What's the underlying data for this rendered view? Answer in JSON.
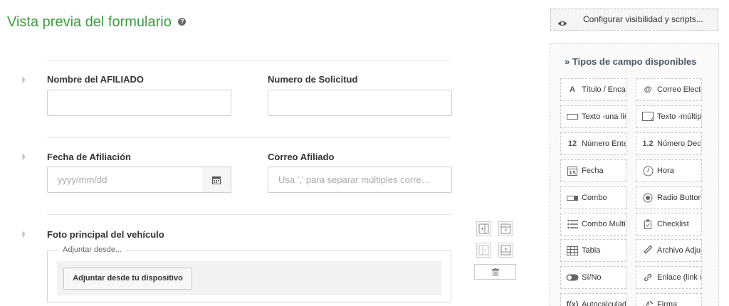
{
  "page": {
    "title": "Vista previa del formulario",
    "help_icon": "question-circle-icon"
  },
  "form": {
    "fields": {
      "nombre": {
        "label": "Nombre del AFILIADO",
        "value": ""
      },
      "solicitud": {
        "label": "Numero de Solicitud",
        "value": ""
      },
      "fecha": {
        "label": "Fecha de Afiliación",
        "placeholder": "yyyy/mm/dd"
      },
      "correo": {
        "label": "Correo Afiliado",
        "placeholder": "Usa ',' para separar múltiples corre…"
      },
      "foto": {
        "label": "Foto principal del vehículo",
        "legend": "Adjuntar desde...",
        "button": "Adjuntar desde tu dispositivo"
      }
    }
  },
  "toolbar": {
    "config_button": "Configurar visibilidad y scripts..."
  },
  "panel": {
    "title": "» Tipos de campo disponibles",
    "items": [
      {
        "icon": "A",
        "label": "Título / Encabezado"
      },
      {
        "icon": "@",
        "label": "Correo Electrónico"
      },
      {
        "icon": "text-line-icon",
        "label": "Texto -una línea"
      },
      {
        "icon": "textarea-icon",
        "label": "Texto -múltiples líneas"
      },
      {
        "icon": "12",
        "label": "Número Entero"
      },
      {
        "icon": "1.2",
        "label": "Número Decimal"
      },
      {
        "icon": "calendar-icon",
        "label": "Fecha"
      },
      {
        "icon": "clock-icon",
        "label": "Hora"
      },
      {
        "icon": "combo-icon",
        "label": "Combo"
      },
      {
        "icon": "radio-icon",
        "label": "Radio Button"
      },
      {
        "icon": "list-icon",
        "label": "Combo Multiple"
      },
      {
        "icon": "checklist-icon",
        "label": "Checklist"
      },
      {
        "icon": "table-icon",
        "label": "Tabla"
      },
      {
        "icon": "paperclip-icon",
        "label": "Archivo Adjunto"
      },
      {
        "icon": "toggle-icon",
        "label": "Sí/No"
      },
      {
        "icon": "link-icon",
        "label": "Enlace (link web)"
      },
      {
        "icon": "f(x)",
        "label": "Autocalculado"
      },
      {
        "icon": "signature-icon",
        "label": "Firma"
      }
    ]
  }
}
